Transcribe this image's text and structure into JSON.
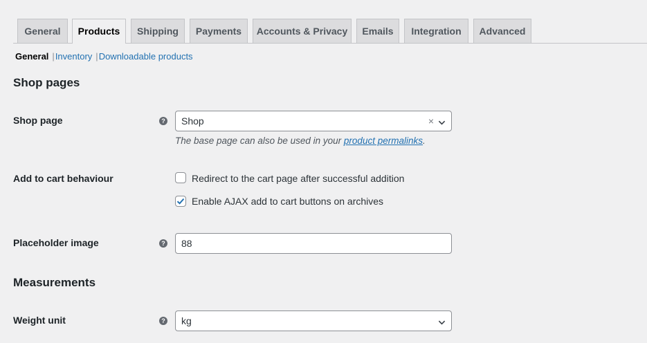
{
  "tabs": [
    {
      "label": "General"
    },
    {
      "label": "Products"
    },
    {
      "label": "Shipping"
    },
    {
      "label": "Payments"
    },
    {
      "label": "Accounts & Privacy"
    },
    {
      "label": "Emails"
    },
    {
      "label": "Integration"
    },
    {
      "label": "Advanced"
    }
  ],
  "active_tab": "Products",
  "subnav": {
    "current": "General",
    "separator": "|",
    "links": [
      "Inventory",
      "Downloadable products"
    ]
  },
  "shop_pages": {
    "heading": "Shop pages",
    "shop_page": {
      "label": "Shop page",
      "value": "Shop",
      "clear_glyph": "×",
      "description_prefix": "The base page can also be used in your ",
      "description_link": "product permalinks",
      "description_suffix": "."
    },
    "add_to_cart": {
      "label": "Add to cart behaviour",
      "options": [
        {
          "label": "Redirect to the cart page after successful addition",
          "checked": false
        },
        {
          "label": "Enable AJAX add to cart buttons on archives",
          "checked": true
        }
      ]
    },
    "placeholder_image": {
      "label": "Placeholder image",
      "value": "88"
    }
  },
  "measurements": {
    "heading": "Measurements",
    "weight_unit": {
      "label": "Weight unit",
      "value": "kg"
    }
  },
  "help_glyph": "?",
  "icons": {
    "help": "question-circle-icon",
    "dropdown": "chevron-down-icon",
    "clear": "close-icon",
    "check": "checkmark-icon"
  },
  "colors": {
    "background": "#f0f0f1",
    "link": "#2271b1",
    "checkbox_tick": "#2271b1",
    "tab_inactive": "#dcdcde"
  }
}
